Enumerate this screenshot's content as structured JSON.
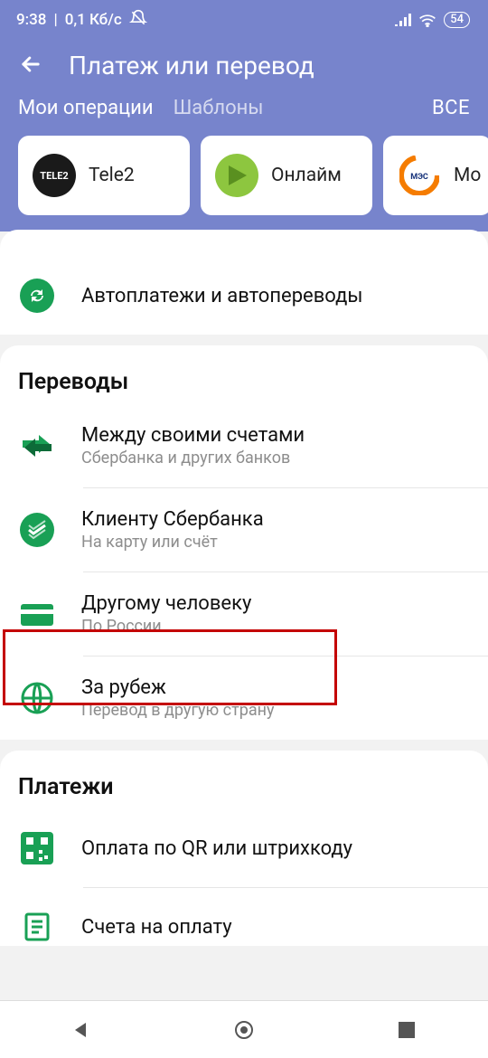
{
  "status": {
    "time": "9:38",
    "net_speed": "0,1 Кб/с",
    "battery": "54"
  },
  "header": {
    "title": "Платеж или перевод"
  },
  "tabs": {
    "active": "Мои операции",
    "inactive": "Шаблоны",
    "all": "ВСЕ"
  },
  "templates": [
    {
      "label": "Tele2"
    },
    {
      "label": "Онлайм"
    },
    {
      "label": "Мо"
    }
  ],
  "auto": {
    "title": "Автоплатежи и автопереводы"
  },
  "transfers": {
    "heading": "Переводы",
    "items": [
      {
        "title": "Между своими счетами",
        "sub": "Сбербанка и других банков"
      },
      {
        "title": "Клиенту Сбербанка",
        "sub": "На карту или счёт"
      },
      {
        "title": "Другому человеку",
        "sub": "По России"
      },
      {
        "title": "За рубеж",
        "sub": "Перевод в другую страну"
      }
    ]
  },
  "payments": {
    "heading": "Платежи",
    "items": [
      {
        "title": "Оплата по QR или штрихкоду"
      },
      {
        "title": "Счета на оплату"
      }
    ]
  }
}
